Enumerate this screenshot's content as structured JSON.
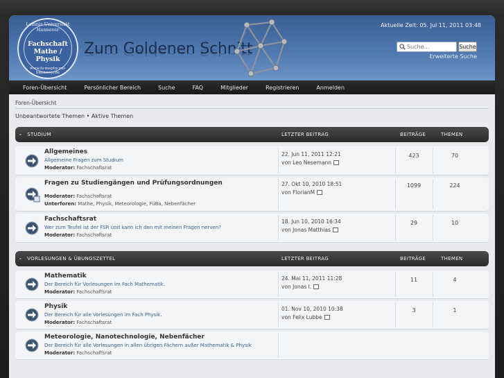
{
  "header": {
    "logo_ring_top": "Leibniz Universität Hannover",
    "logo_title_line1": "Fachschaft",
    "logo_title_line2": "Mathe / Physik",
    "logo_ring_bottom": "www.fs-maphy.uni-hannover.de",
    "site_title": "Zum Goldenen Schnitt",
    "clock": "Aktuelle Zeit: 05. Jul 11, 2011 03:48",
    "search_placeholder": "Suche…",
    "search_button": "Suche",
    "advanced_search": "Erweiterte Suche"
  },
  "nav": {
    "items": [
      "Foren-Übersicht",
      "Persönlicher Bereich",
      "Suche",
      "FAQ",
      "Mitglieder",
      "Registrieren",
      "Anmelden"
    ]
  },
  "breadcrumb": "Foren-Übersicht",
  "quicklinks": {
    "unanswered": "Unbeantwortete Themen",
    "sep": "•",
    "active": "Aktive Themen"
  },
  "columns": {
    "last_post": "LETZTER BEITRAG",
    "posts": "BEITRÄGE",
    "topics": "THEMEN"
  },
  "categories": [
    {
      "title": "STUDIUM",
      "forums": [
        {
          "name": "Allgemeines",
          "desc": "Allgemeine Fragen zum Studium",
          "mod_label": "Moderator:",
          "mod": "Fachschaftsrat",
          "last_date": "22. Jun 11, 2011 12:21",
          "last_by": "von Leo Nesemann",
          "posts": "423",
          "topics": "70"
        },
        {
          "name": "Fragen zu Studiengängen und Prüfungsordnungen",
          "desc": "",
          "mod_label": "Moderator:",
          "mod": "Fachschaftsrat",
          "sub_label": "Unterforen:",
          "sub": "Mathe, Physik, Meteorologie, FüBa, Nebenfächer",
          "last_date": "27. Okt 10, 2010 18:51",
          "last_by": "von FlorianM",
          "posts": "1099",
          "topics": "224"
        },
        {
          "name": "Fachschaftsrat",
          "desc": "Wer zum Teufel ist der FSR und kann ich den mit meinen Fragen nerven?",
          "mod_label": "Moderator:",
          "mod": "Fachschaftsrat",
          "last_date": "18. Jun 10, 2010 16:34",
          "last_by": "von Jonas Matthias",
          "posts": "29",
          "topics": "10"
        }
      ]
    },
    {
      "title": "VORLESUNGEN & ÜBUNGSZETTEL",
      "forums": [
        {
          "name": "Mathematik",
          "desc": "Der Bereich für Vorlesungen im Fach Mathematik.",
          "mod_label": "Moderator:",
          "mod": "Fachschaftsrat",
          "last_date": "24. Mai 11, 2011 11:28",
          "last_by": "von Jonas I.",
          "posts": "11",
          "topics": "4"
        },
        {
          "name": "Physik",
          "desc": "Der Bereich für alle Vorlesungen im Fach Physik.",
          "mod_label": "Moderator:",
          "mod": "Fachschaftsrat",
          "last_date": "01. Nov 10, 2010 10:38",
          "last_by": "von Felix Lubbe",
          "posts": "3",
          "topics": "1"
        },
        {
          "name": "Meteorologie, Nanotechnologie, Nebenfächer",
          "desc": "Der Bereich für alle Vorlesungen in allen übrigen Fächern außer Mathematik & Physik",
          "mod_label": "Moderator:",
          "mod": "Fachschaftsrat",
          "last_date": "",
          "last_by": "",
          "posts": "",
          "topics": ""
        }
      ]
    }
  ],
  "colors": {
    "header_blue": "#4f78b0",
    "nav_dark": "#222222",
    "link_blue": "#3a5e91"
  }
}
